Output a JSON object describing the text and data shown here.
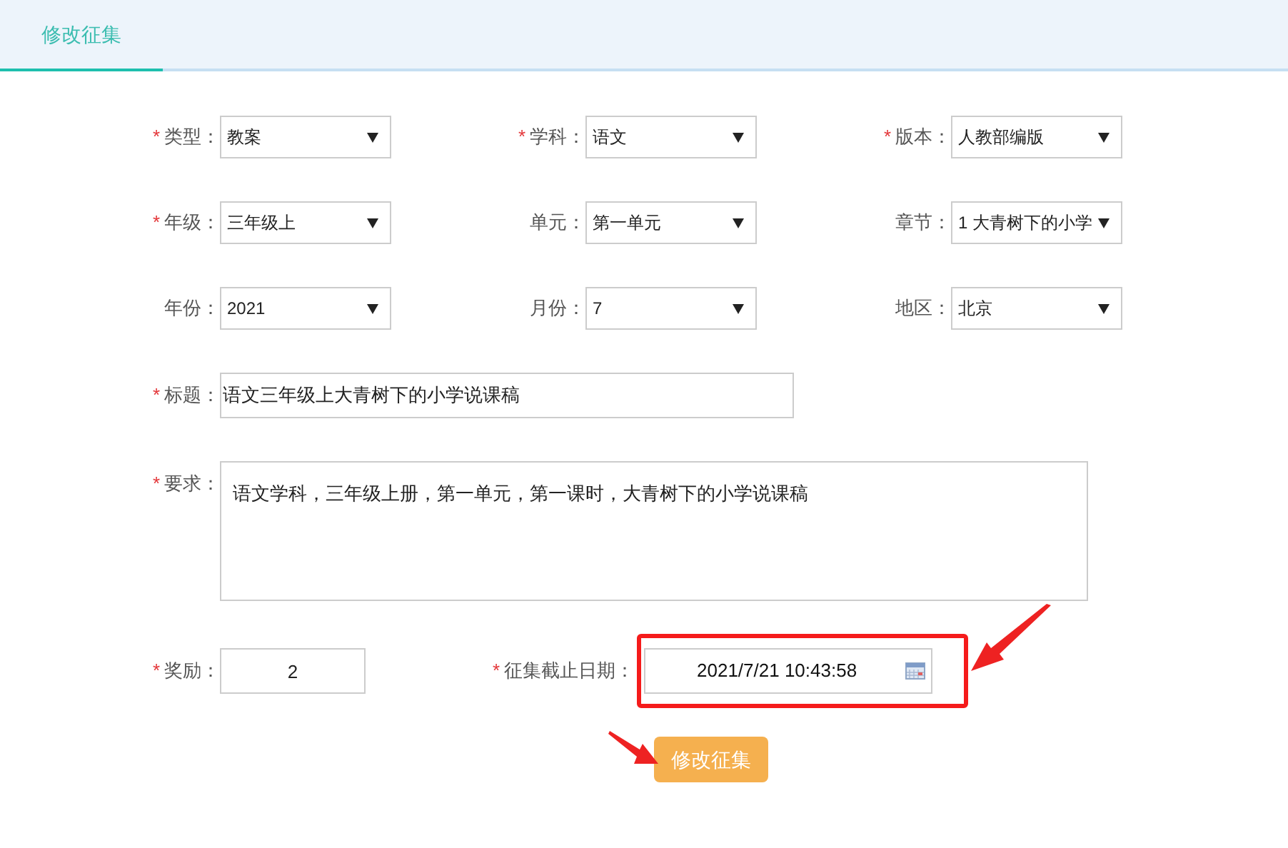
{
  "tabs": [
    {
      "label": "修改征集",
      "selected": true
    }
  ],
  "selects": [
    {
      "label": "类型：",
      "required_mark": "*",
      "value": "教案"
    },
    {
      "label": "学科：",
      "required_mark": "*",
      "value": "语文"
    },
    {
      "label": "版本：",
      "required_mark": "*",
      "value": "人教部编版"
    },
    {
      "label": "年级：",
      "required_mark": "*",
      "value": "三年级上"
    },
    {
      "label": "单元：",
      "value": "第一单元"
    },
    {
      "label": "章节：",
      "value": "1 大青树下的小学"
    },
    {
      "label": "年份：",
      "value": "2021"
    },
    {
      "label": "月份：",
      "value": "7"
    },
    {
      "label": "地区：",
      "value": "北京"
    }
  ],
  "title": {
    "label": "标题：",
    "required_mark": "*",
    "value": "语文三年级上大青树下的小学说课稿"
  },
  "requirement": {
    "label": "要求：",
    "required_mark": "*",
    "value": "语文学科，三年级上册，第一单元，第一课时，大青树下的小学说课稿"
  },
  "reward": {
    "label": "奖励：",
    "required_mark": "*",
    "value": "2"
  },
  "deadline": {
    "label": "征集截止日期：",
    "required_mark": "*",
    "value": "2021/7/21 10:43:58",
    "highlighted": true
  },
  "submit_button": "修改征集"
}
